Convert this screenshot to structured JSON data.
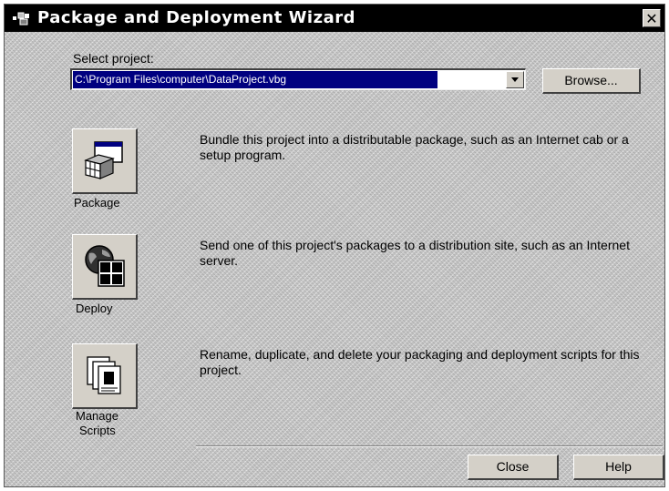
{
  "window": {
    "title": "Package and Deployment Wizard",
    "close_label": "✕"
  },
  "project": {
    "select_label": "Select project:",
    "path": "C:\\Program Files\\computer\\DataProject.vbg",
    "browse_label": "Browse..."
  },
  "actions": [
    {
      "name": "package",
      "label": "Package",
      "description": "Bundle this project into a distributable package, such as an Internet cab or a setup program."
    },
    {
      "name": "deploy",
      "label": "Deploy",
      "description": "Send one of this project's packages to a distribution site, such as an Internet server."
    },
    {
      "name": "manage",
      "label_line1": "Manage",
      "label_line2": "Scripts",
      "description": "Rename, duplicate, and delete your packaging and deployment scripts for this project."
    }
  ],
  "footer": {
    "close_label": "Close",
    "help_label": "Help"
  },
  "icons": {
    "title": "wizard-box-icon",
    "package": "package-box-icon",
    "deploy": "globe-deploy-icon",
    "manage": "scripts-pages-icon"
  },
  "colors": {
    "title_bar": "#000000",
    "selection": "#000080",
    "face": "#d4d0c8"
  }
}
